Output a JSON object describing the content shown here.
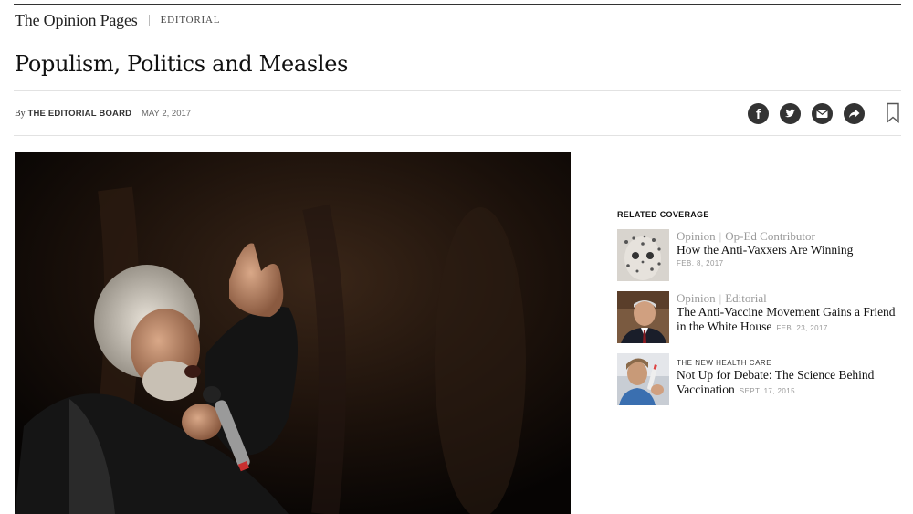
{
  "masthead": {
    "brand": "The Opinion Pages",
    "section": "EDITORIAL"
  },
  "article": {
    "headline": "Populism, Politics and Measles",
    "by_prefix": "By",
    "author": "THE EDITORIAL BOARD",
    "date": "MAY 2, 2017"
  },
  "share": {
    "icons": [
      "facebook-icon",
      "twitter-icon",
      "email-icon",
      "share-icon",
      "bookmark-icon"
    ]
  },
  "related": {
    "heading": "RELATED COVERAGE",
    "items": [
      {
        "kicker_left": "Opinion",
        "kicker_right": "Op-Ed Contributor",
        "title": "How the Anti-Vaxxers Are Winning",
        "date": "FEB. 8, 2017"
      },
      {
        "kicker_left": "Opinion",
        "kicker_right": "Editorial",
        "title_line1": "The Anti-Vaccine Movement Gains a Friend",
        "title_line2": "in the White House",
        "date": "FEB. 23, 2017"
      },
      {
        "kicker": "THE NEW HEALTH CARE",
        "title_line1": "Not Up for Debate: The Science Behind",
        "title_line2": "Vaccination",
        "date": "SEPT. 17, 2015"
      }
    ]
  },
  "colors": {
    "icon_fill": "#333333",
    "rule": "#e2e2e2",
    "muted": "#999999"
  }
}
